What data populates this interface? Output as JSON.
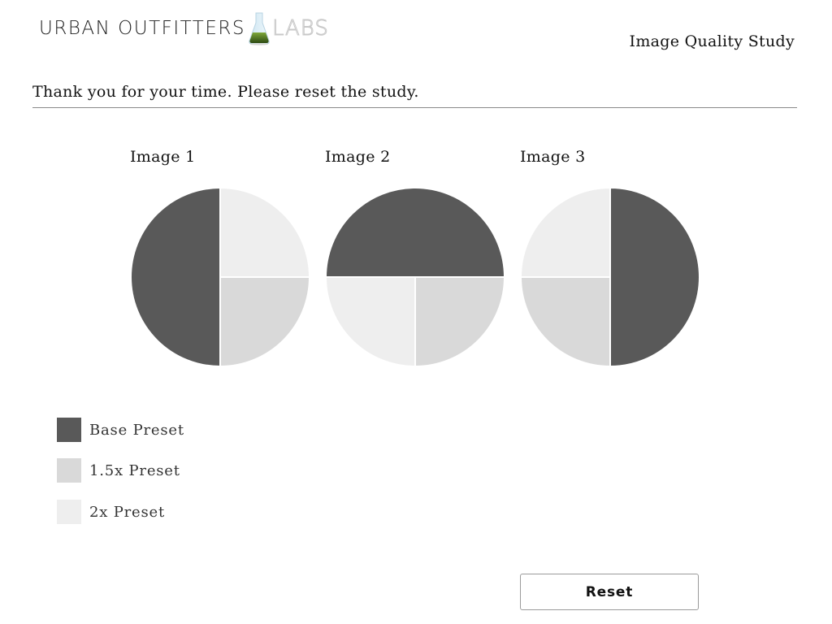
{
  "header": {
    "logo": {
      "brand": "URBAN OUTFITTERS",
      "sub": "LABS",
      "icon": "flask-icon"
    },
    "app_title": "Image Quality Study"
  },
  "main": {
    "message": "Thank you for your time. Please reset the study.",
    "reset_label": "Reset"
  },
  "legend": {
    "items": [
      {
        "label": "Base Preset",
        "color": "#595959"
      },
      {
        "label": "1.5x Preset",
        "color": "#d9d9d9"
      },
      {
        "label": "2x Preset",
        "color": "#eeeeee"
      }
    ]
  },
  "chart_data": [
    {
      "type": "pie",
      "title": "Image 1",
      "categories": [
        "Base Preset",
        "1.5x Preset",
        "2x Preset"
      ],
      "values": [
        2,
        1,
        1
      ]
    },
    {
      "type": "pie",
      "title": "Image 2",
      "categories": [
        "Base Preset",
        "1.5x Preset",
        "2x Preset"
      ],
      "values": [
        2,
        1,
        1
      ]
    },
    {
      "type": "pie",
      "title": "Image 3",
      "categories": [
        "Base Preset",
        "1.5x Preset",
        "2x Preset"
      ],
      "values": [
        2,
        1,
        1
      ]
    }
  ]
}
